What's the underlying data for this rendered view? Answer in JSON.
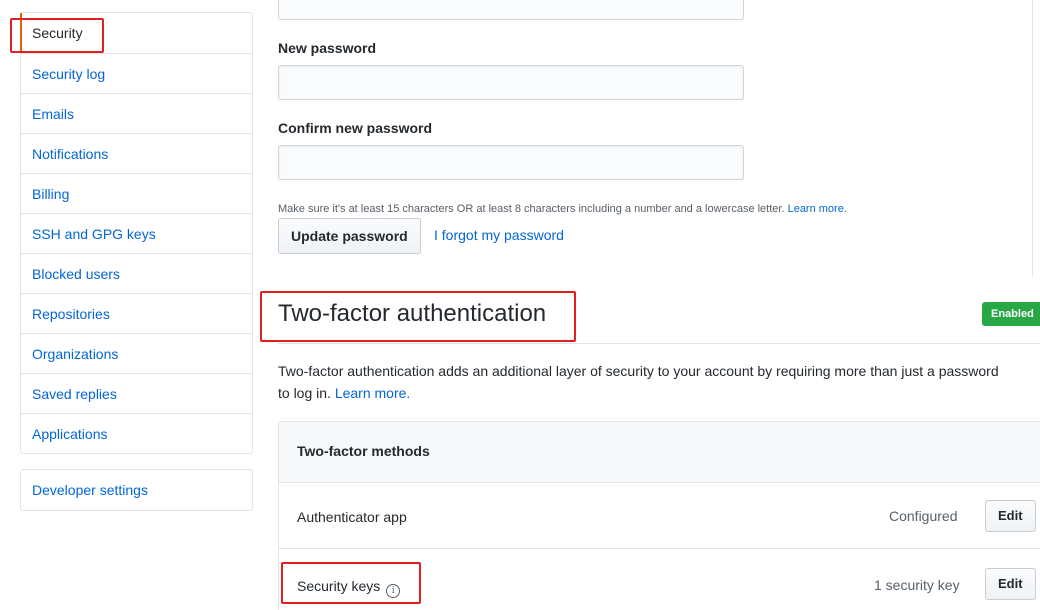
{
  "sidebar": {
    "items": [
      {
        "label": "Security"
      },
      {
        "label": "Security log"
      },
      {
        "label": "Emails"
      },
      {
        "label": "Notifications"
      },
      {
        "label": "Billing"
      },
      {
        "label": "SSH and GPG keys"
      },
      {
        "label": "Blocked users"
      },
      {
        "label": "Repositories"
      },
      {
        "label": "Organizations"
      },
      {
        "label": "Saved replies"
      },
      {
        "label": "Applications"
      }
    ],
    "developer_settings": "Developer settings",
    "selected": "Security"
  },
  "password": {
    "new_label": "New password",
    "confirm_label": "Confirm new password",
    "hint": "Make sure it's at least 15 characters OR at least 8 characters including a number and a lowercase letter.",
    "hint_link": "Learn more.",
    "update_button": "Update password",
    "forgot_link": "I forgot my password"
  },
  "two_factor": {
    "title": "Two-factor authentication",
    "status_badge": "Enabled",
    "description": "Two-factor authentication adds an additional layer of security to your account by requiring more than just a password",
    "description_line2": "to log in.",
    "learn_more": "Learn more.",
    "methods_header": "Two-factor methods",
    "methods": [
      {
        "label": "Authenticator app",
        "status": "Configured",
        "action": "Edit"
      },
      {
        "label": "Security keys",
        "status": "1 security key",
        "action": "Edit",
        "info_icon": "info-icon"
      }
    ]
  },
  "colors": {
    "link": "#0366d6",
    "highlight": "#e02020",
    "badge": "#28a745",
    "selected_marker": "#e36209"
  }
}
